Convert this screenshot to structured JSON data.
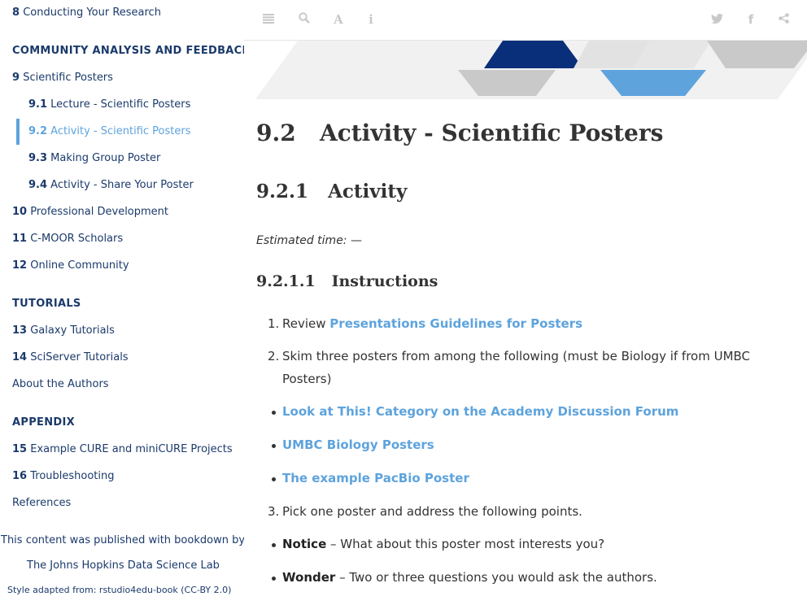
{
  "sidebar": {
    "items": [
      {
        "num": "8",
        "label": "Conducting Your Research"
      },
      {
        "num": "9",
        "label": "Scientific Posters"
      },
      {
        "num": "9.1",
        "label": "Lecture - Scientific Posters"
      },
      {
        "num": "9.2",
        "label": "Activity - Scientific Posters"
      },
      {
        "num": "9.3",
        "label": "Making Group Poster"
      },
      {
        "num": "9.4",
        "label": "Activity - Share Your Poster"
      },
      {
        "num": "10",
        "label": "Professional Development"
      },
      {
        "num": "11",
        "label": "C-MOOR Scholars"
      },
      {
        "num": "12",
        "label": "Online Community"
      },
      {
        "num": "13",
        "label": "Galaxy Tutorials"
      },
      {
        "num": "14",
        "label": "SciServer Tutorials"
      },
      {
        "num": "",
        "label": "About the Authors"
      },
      {
        "num": "15",
        "label": "Example CURE and miniCURE Projects"
      },
      {
        "num": "16",
        "label": "Troubleshooting"
      },
      {
        "num": "",
        "label": "References"
      }
    ],
    "headers": [
      "COMMUNITY ANALYSIS AND FEEDBACK",
      "TUTORIALS",
      "APPENDIX"
    ],
    "footer": {
      "published": "This content was published with bookdown by:",
      "lab": "The Johns Hopkins Data Science Lab",
      "style": "Style adapted from: rstudio4edu-book (CC-BY 2.0)"
    }
  },
  "toolbar": {
    "left_icons": [
      "list-icon",
      "search-icon",
      "font-icon",
      "info-icon"
    ],
    "right_icons": [
      "twitter-icon",
      "facebook-icon",
      "share-icon"
    ]
  },
  "colors": {
    "accent": "#5ea3dc",
    "navy": "#1b3a6b",
    "banner_dark": "#0a2f7a",
    "banner_grey": "#c9c9c9",
    "banner_light": "#f0f0f0"
  },
  "content": {
    "title_num": "9.2",
    "title": "Activity - Scientific Posters",
    "sub_num": "9.2.1",
    "sub": "Activity",
    "estimated": "Estimated time: —",
    "instr_num": "9.2.1.1",
    "instr": "Instructions",
    "steps": {
      "s1_marker": "1.",
      "s1_text": "Review ",
      "s1_link": "Presentations Guidelines for Posters",
      "s2_marker": "2.",
      "s2_line1": "Skim three posters from among the following (must be Biology if from UMBC",
      "s2_line2": "Posters)",
      "b1": "Look at This! Category on the Academy Discussion Forum",
      "b2": "UMBC Biology Posters",
      "b3": "The example PacBio Poster",
      "s3_marker": "3.",
      "s3_text": "Pick one poster and address the following points.",
      "b4_bold": "Notice",
      "b4_text": " – What about this poster most interests you?",
      "b5_bold": "Wonder",
      "b5_text": " – Two or three questions you would ask the authors."
    }
  }
}
